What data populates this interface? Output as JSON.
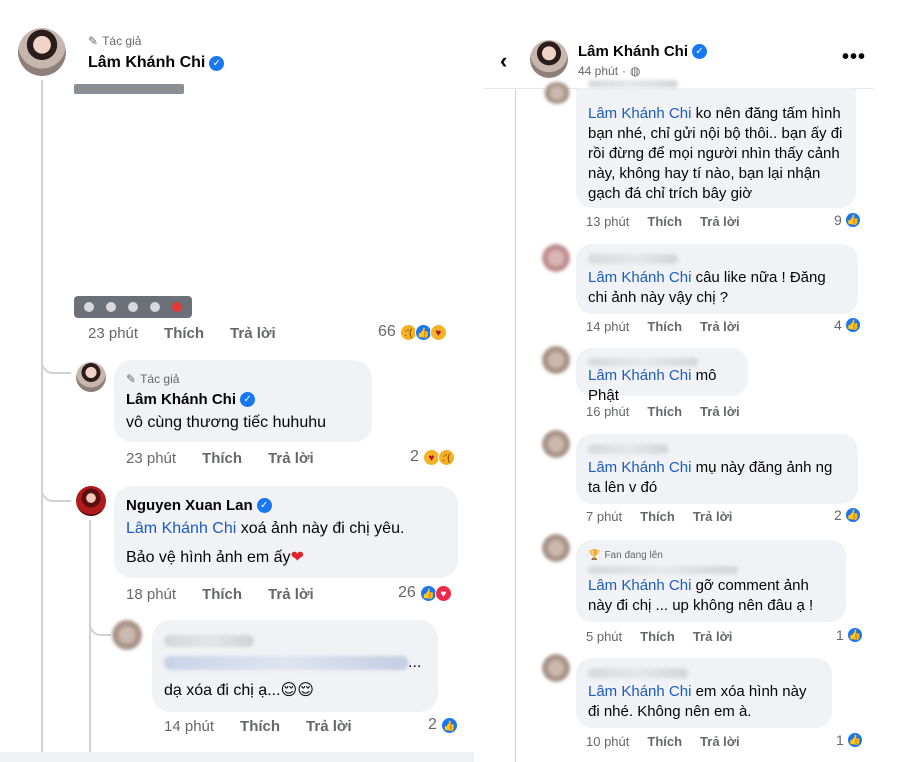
{
  "left": {
    "post": {
      "author_tag": "Tác giả",
      "author_name": "Lâm Khánh Chi",
      "time": "23 phút",
      "like": "Thích",
      "reply": "Trả lời",
      "reaction_count": "66"
    },
    "reply1": {
      "author_tag": "Tác giả",
      "author_name": "Lâm Khánh Chi",
      "text": "vô cùng thương tiếc huhuhu",
      "time": "23 phút",
      "like": "Thích",
      "reply": "Trả lời",
      "reaction_count": "2"
    },
    "reply2": {
      "author_name": "Nguyen Xuan Lan",
      "mention": "Lâm Khánh Chi",
      "text_after_mention": " xoá ảnh này đi chị yêu.",
      "text_line2": "Bảo vệ hình ảnh em ấy",
      "heart": "❤",
      "time": "18 phút",
      "like": "Thích",
      "reply": "Trả lời",
      "reaction_count": "26"
    },
    "reply3": {
      "ellipsis": "...",
      "text": "dạ xóa đi chị ạ...😌😌",
      "time": "14 phút",
      "like": "Thích",
      "reply": "Trả lời",
      "reaction_count": "2"
    }
  },
  "right": {
    "header": {
      "name": "Lâm Khánh Chi",
      "time": "44 phút",
      "more": "•••"
    },
    "comments": [
      {
        "mention": "Lâm Khánh Chi",
        "text": " ko nên đăng tấm hình bạn nhé, chỉ gửi nội bộ thôi.. bạn ấy đi rồi đừng để mọi người nhìn thấy cảnh này, không hay tí nào, bạn lại nhận gạch đá chỉ trích bây giờ",
        "time": "13 phút",
        "like": "Thích",
        "reply": "Trả lời",
        "count": "9"
      },
      {
        "mention": "Lâm Khánh Chi",
        "text": " câu like nữa ! Đăng chi ảnh này vậy chị ?",
        "time": "14 phút",
        "like": "Thích",
        "reply": "Trả lời",
        "count": "4"
      },
      {
        "mention": "Lâm Khánh Chi",
        "text": " mô Phật",
        "time": "16 phút",
        "like": "Thích",
        "reply": "Trả lời",
        "count": ""
      },
      {
        "mention": "Lâm Khánh Chi",
        "text": " mụ này đăng ảnh ng ta lên v đó",
        "time": "7 phút",
        "like": "Thích",
        "reply": "Trả lời",
        "count": "2"
      },
      {
        "badge": "Fan đang lên",
        "mention": "Lâm Khánh Chi",
        "text": " gỡ comment ảnh này đi chị ... up không nên đâu ạ !",
        "time": "5 phút",
        "like": "Thích",
        "reply": "Trả lời",
        "count": "1"
      },
      {
        "mention": "Lâm Khánh Chi",
        "text": " em xóa hình này đi nhé. Không nên em à.",
        "time": "10 phút",
        "like": "Thích",
        "reply": "Trả lời",
        "count": "1"
      }
    ]
  }
}
